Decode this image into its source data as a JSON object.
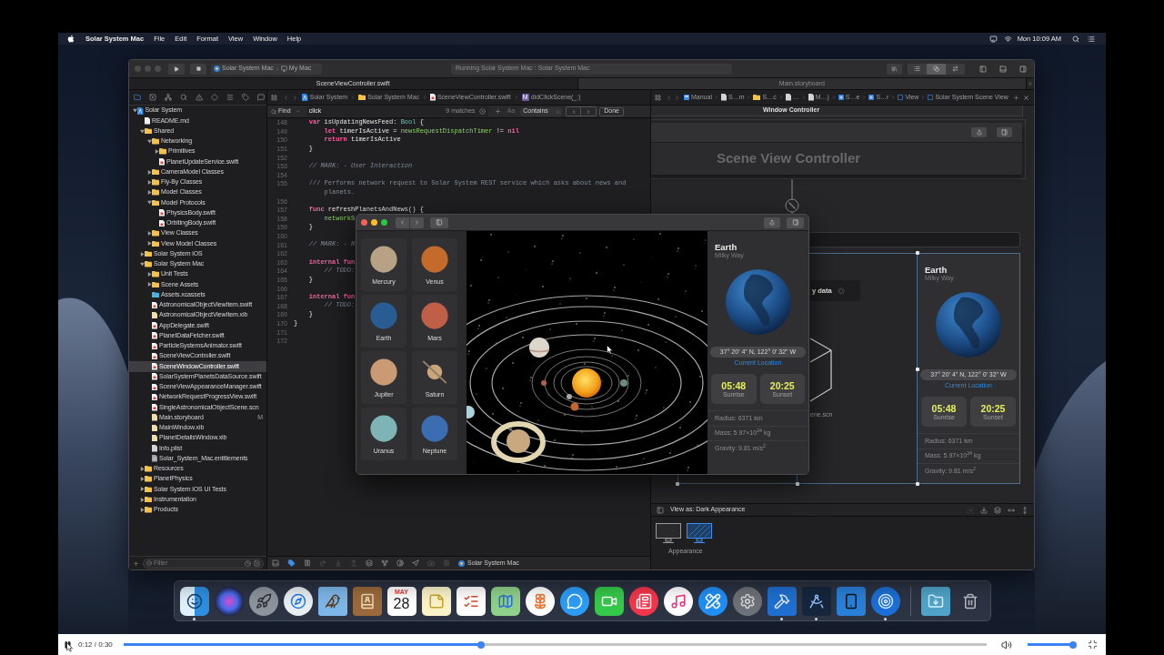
{
  "menu_bar": {
    "app_name": "Solar System Mac",
    "menus": [
      "File",
      "Edit",
      "Format",
      "View",
      "Window",
      "Help"
    ],
    "clock": "Mon 10:09 AM"
  },
  "xcode": {
    "toolbar": {
      "scheme": "Solar System Mac",
      "destination": "My Mac",
      "status": "Running Solar System Mac : Solar System Mac",
      "editor_modes": [
        {
          "kind": "standard",
          "selected": false
        },
        {
          "kind": "assistant",
          "selected": true
        },
        {
          "kind": "version",
          "selected": false
        }
      ]
    },
    "tabs": [
      {
        "label": "SceneViewController.swift",
        "selected": true
      },
      {
        "label": "Main.storyboard",
        "selected": false
      }
    ],
    "navigator": {
      "tabs": [
        {
          "kind": "files",
          "selected": true
        },
        {
          "kind": "sourcecontrol",
          "selected": false
        },
        {
          "kind": "symbols",
          "selected": false
        },
        {
          "kind": "find",
          "selected": false
        },
        {
          "kind": "issues",
          "selected": false
        },
        {
          "kind": "tests",
          "selected": false
        },
        {
          "kind": "debug",
          "selected": false
        },
        {
          "kind": "breakpoints",
          "selected": false
        },
        {
          "kind": "reports",
          "selected": false
        }
      ],
      "items": [
        {
          "name": "Solar System",
          "kind": "project",
          "selected": false,
          "expanded": true,
          "children": [
            {
              "name": "README.md",
              "kind": "markdown",
              "selected": false
            },
            {
              "name": "Shared",
              "kind": "folder",
              "selected": false,
              "expanded": true,
              "children": [
                {
                  "name": "Networking",
                  "kind": "folder",
                  "selected": false,
                  "expanded": true,
                  "children": [
                    {
                      "name": "Primitives",
                      "kind": "folder",
                      "selected": false,
                      "expanded": false
                    },
                    {
                      "name": "PlanetUpdateService.swift",
                      "kind": "swift",
                      "selected": false
                    }
                  ]
                },
                {
                  "name": "CameraModel Classes",
                  "kind": "folder",
                  "selected": false,
                  "expanded": false
                },
                {
                  "name": "Fly-By Classes",
                  "kind": "folder",
                  "selected": false,
                  "expanded": false
                },
                {
                  "name": "Model Classes",
                  "kind": "folder",
                  "selected": false,
                  "expanded": false
                },
                {
                  "name": "Model Protocols",
                  "kind": "folder",
                  "selected": false,
                  "expanded": true,
                  "children": [
                    {
                      "name": "PhysicsBody.swift",
                      "kind": "swift",
                      "selected": false
                    },
                    {
                      "name": "OrbitingBody.swift",
                      "kind": "swift",
                      "selected": false
                    }
                  ]
                },
                {
                  "name": "View Classes",
                  "kind": "folder",
                  "selected": false,
                  "expanded": false
                },
                {
                  "name": "View Model Classes",
                  "kind": "folder",
                  "selected": false,
                  "expanded": false
                }
              ]
            },
            {
              "name": "Solar System iOS",
              "kind": "folder",
              "selected": false,
              "expanded": false
            },
            {
              "name": "Solar System Mac",
              "kind": "folder",
              "selected": false,
              "expanded": true,
              "children": [
                {
                  "name": "Unit Tests",
                  "kind": "folder",
                  "selected": false,
                  "expanded": false
                },
                {
                  "name": "Scene Assets",
                  "kind": "folder",
                  "selected": false,
                  "expanded": false
                },
                {
                  "name": "Assets.xcassets",
                  "kind": "assets",
                  "selected": false
                },
                {
                  "name": "AstronomicalObjectViewItem.swift",
                  "kind": "swift",
                  "selected": false
                },
                {
                  "name": "AstronomicalObjectViewItem.xib",
                  "kind": "interface",
                  "selected": false
                },
                {
                  "name": "AppDelegate.swift",
                  "kind": "swift",
                  "selected": false
                },
                {
                  "name": "PlanetDataFetcher.swift",
                  "kind": "swift",
                  "selected": false
                },
                {
                  "name": "ParticleSystemsAnimator.swift",
                  "kind": "swift",
                  "selected": false
                },
                {
                  "name": "SceneViewController.swift",
                  "kind": "swift",
                  "selected": false
                },
                {
                  "name": "SceneWindowController.swift",
                  "kind": "swift",
                  "selected": true
                },
                {
                  "name": "SolarSystemPlanetsDataSource.swift",
                  "kind": "swift",
                  "selected": false
                },
                {
                  "name": "SceneViewAppearanceManager.swift",
                  "kind": "swift",
                  "selected": false
                },
                {
                  "name": "NetworkRequestProgressView.swift",
                  "kind": "swift",
                  "selected": false
                },
                {
                  "name": "SingleAstronomicalObjectScene.scn",
                  "kind": "scene",
                  "selected": false
                },
                {
                  "name": "Main.storyboard",
                  "kind": "interface",
                  "selected": false,
                  "badge": "M"
                },
                {
                  "name": "MainWindow.xib",
                  "kind": "interface",
                  "selected": false
                },
                {
                  "name": "PlanetDetailsWindow.xib",
                  "kind": "interface",
                  "selected": false
                },
                {
                  "name": "Info.plist",
                  "kind": "plist",
                  "selected": false
                },
                {
                  "name": "Solar_System_Mac.entitlements",
                  "kind": "entitlements",
                  "selected": false
                }
              ]
            },
            {
              "name": "Resources",
              "kind": "folder",
              "selected": false,
              "expanded": false
            },
            {
              "name": "PlanetPhysics",
              "kind": "folder",
              "selected": false,
              "expanded": false
            },
            {
              "name": "Solar System iOS UI Tests",
              "kind": "folder",
              "selected": false,
              "expanded": false
            },
            {
              "name": "Instrumentation",
              "kind": "folder",
              "selected": false,
              "expanded": false
            },
            {
              "name": "Products",
              "kind": "folder",
              "selected": false,
              "expanded": false
            }
          ]
        }
      ],
      "filter": {
        "placeholder": "Filter"
      }
    },
    "editor": {
      "jump_bar": [
        {
          "kind": "project",
          "label": "Solar System"
        },
        {
          "kind": "folder",
          "label": "Solar System Mac"
        },
        {
          "kind": "swift",
          "label": "SceneViewController.swift"
        },
        {
          "kind": "method",
          "badge": "M",
          "label": "didClickScene(_:)"
        }
      ],
      "find_bar": {
        "mode": "Find",
        "query": "click",
        "matches": "9 matches",
        "case_toggle": "Aa",
        "match_type": "Contains",
        "done": "Done"
      },
      "lines": [
        {
          "number": "148",
          "tokens": [
            {
              "text": "    var",
              "kind": "keyword"
            },
            {
              "text": " isUpdatingNewsFeed: ",
              "kind": "plain"
            },
            {
              "text": "Bool",
              "kind": "type"
            },
            {
              "text": " {",
              "kind": "plain"
            }
          ]
        },
        {
          "number": "149",
          "tokens": [
            {
              "text": "        let",
              "kind": "keyword"
            },
            {
              "text": " timerIsActive = ",
              "kind": "plain"
            },
            {
              "text": "newsRequestDispatchTimer",
              "kind": "project"
            },
            {
              "text": " != ",
              "kind": "plain"
            },
            {
              "text": "nil",
              "kind": "keyword"
            }
          ]
        },
        {
          "number": "150",
          "tokens": [
            {
              "text": "        return",
              "kind": "keyword"
            },
            {
              "text": " timerIsActive",
              "kind": "plain"
            }
          ]
        },
        {
          "number": "151",
          "tokens": [
            {
              "text": "    }",
              "kind": "plain"
            }
          ]
        },
        {
          "number": "152"
        },
        {
          "number": "153",
          "tokens": [
            {
              "text": "    // MARK: - User Interaction",
              "kind": "comment"
            }
          ]
        },
        {
          "number": "154"
        },
        {
          "number": "155",
          "tokens": [
            {
              "text": "    /// Performs network request to Solar System REST service which asks about news and",
              "kind": "doc"
            }
          ]
        },
        {
          "tokens": [
            {
              "text": "        planets.",
              "kind": "doc"
            }
          ]
        },
        {
          "number": "156"
        },
        {
          "number": "157",
          "tokens": [
            {
              "text": "    func",
              "kind": "keyword"
            },
            {
              "text": " refreshPlanetsAndNews() {",
              "kind": "plain"
            }
          ]
        },
        {
          "number": "158",
          "tokens": [
            {
              "text": "        networkS",
              "kind": "project"
            }
          ]
        },
        {
          "number": "159",
          "tokens": [
            {
              "text": "    }",
              "kind": "plain"
            }
          ]
        },
        {
          "number": "160"
        },
        {
          "number": "161",
          "tokens": [
            {
              "text": "    // MARK: - N",
              "kind": "comment"
            }
          ]
        },
        {
          "number": "162"
        },
        {
          "number": "163",
          "tokens": [
            {
              "text": "    internal fun",
              "kind": "keyword"
            }
          ]
        },
        {
          "number": "164",
          "tokens": [
            {
              "text": "        // TODO:",
              "kind": "comment"
            }
          ]
        },
        {
          "number": "165",
          "tokens": [
            {
              "text": "    }",
              "kind": "plain"
            }
          ]
        },
        {
          "number": "166"
        },
        {
          "number": "167",
          "tokens": [
            {
              "text": "    internal fun",
              "kind": "keyword"
            }
          ]
        },
        {
          "number": "168",
          "tokens": [
            {
              "text": "        // TODO:",
              "kind": "comment"
            }
          ]
        },
        {
          "number": "169",
          "tokens": [
            {
              "text": "    }",
              "kind": "plain"
            }
          ]
        },
        {
          "number": "170",
          "tokens": [
            {
              "text": "}",
              "kind": "plain"
            }
          ]
        },
        {
          "number": "171"
        },
        {
          "number": "172"
        }
      ]
    },
    "debug_bar": {
      "breakpoints_active": true,
      "target": "Solar System Mac"
    },
    "storyboard": {
      "jump_bar": [
        {
          "kind": "storyboard",
          "label": "Manual"
        },
        {
          "kind": "file",
          "label": "S…m"
        },
        {
          "kind": "folder",
          "label": "S…c"
        },
        {
          "kind": "file",
          "label": "…"
        },
        {
          "kind": "file",
          "label": "M…)"
        },
        {
          "kind": "scene",
          "label": "S…e"
        },
        {
          "kind": "scene",
          "label": "S…r"
        },
        {
          "kind": "view",
          "label": "View"
        },
        {
          "kind": "view",
          "label": "Solar System Scene View"
        }
      ],
      "window_controller": "Window Controller",
      "scene_view_controller": "Scene View Controller",
      "split_view": {
        "loading_text": "y data",
        "scene_file": "ene.scn",
        "details": {
          "title": "Earth",
          "subtitle": "Milky Way",
          "coordinates": "37° 20' 4\" N, 122° 0' 32\" W",
          "location_link": "Current Location",
          "times": [
            {
              "value": "05:48",
              "caption": "Sunrise"
            },
            {
              "value": "20:25",
              "caption": "Sunset"
            }
          ],
          "properties": [
            "Radius: 6371 km",
            "Mass: 5.97×10$^{24}$ kg",
            "Gravity: 9.81 m/s$^{2}$"
          ]
        }
      },
      "view_as": "View as: Dark Appearance",
      "appearances": [
        {
          "kind": "light",
          "selected": false
        },
        {
          "kind": "dark",
          "selected": true
        }
      ],
      "appearance_label": "Appearance"
    }
  },
  "app_window": {
    "planets": [
      {
        "name": "Mercury",
        "color": "#b8a286",
        "ringed": false
      },
      {
        "name": "Venus",
        "color": "#c46a2a",
        "ringed": false
      },
      {
        "name": "Earth",
        "color": "#2a5c94",
        "ringed": false
      },
      {
        "name": "Mars",
        "color": "#bf5f48",
        "ringed": false
      },
      {
        "name": "Jupiter",
        "color": "#c99a74",
        "ringed": false
      },
      {
        "name": "Saturn",
        "color": "#caa47a",
        "ringed": true
      },
      {
        "name": "Uranus",
        "color": "#7fb4b6",
        "ringed": false
      },
      {
        "name": "Neptune",
        "color": "#3b6db2",
        "ringed": false
      }
    ],
    "details": {
      "title": "Earth",
      "subtitle": "Milky Way",
      "coordinates": "37° 20' 4\" N, 122° 0' 32\" W",
      "location_link": "Current Location",
      "times": [
        {
          "value": "05:48",
          "caption": "Sunrise"
        },
        {
          "value": "20:25",
          "caption": "Sunset"
        }
      ],
      "properties": [
        "Radius: 6371 km",
        "Mass: 5.97×10$^{24}$ kg",
        "Gravity: 9.81 m/s$^{2}$"
      ]
    }
  },
  "dock": [
    {
      "kind": "finder",
      "running": true
    },
    {
      "kind": "siri",
      "running": false
    },
    {
      "kind": "launchpad",
      "running": false
    },
    {
      "kind": "safari",
      "running": false
    },
    {
      "kind": "mail",
      "running": false
    },
    {
      "kind": "contacts",
      "running": false
    },
    {
      "kind": "calendar",
      "running": false,
      "month": "MAY",
      "day": "28"
    },
    {
      "kind": "notes",
      "running": false
    },
    {
      "kind": "reminders",
      "running": false
    },
    {
      "kind": "maps",
      "running": false
    },
    {
      "kind": "photos",
      "running": false
    },
    {
      "kind": "messages",
      "running": false
    },
    {
      "kind": "facetime",
      "running": false
    },
    {
      "kind": "news",
      "running": false
    },
    {
      "kind": "music",
      "running": false
    },
    {
      "kind": "appstore",
      "running": false
    },
    {
      "kind": "preferences",
      "running": false
    },
    {
      "kind": "xcode",
      "running": true
    },
    {
      "kind": "instruments",
      "running": true
    },
    {
      "kind": "simulator",
      "running": false
    },
    {
      "kind": "radar",
      "running": true
    },
    {
      "kind": "separator"
    },
    {
      "kind": "downloads",
      "running": false
    },
    {
      "kind": "trash",
      "running": false
    }
  ],
  "video_player": {
    "playing": true,
    "time": "0:12 / 0:30",
    "progress": {
      "level": 0.414
    },
    "volume": {
      "level": 0.96
    }
  }
}
